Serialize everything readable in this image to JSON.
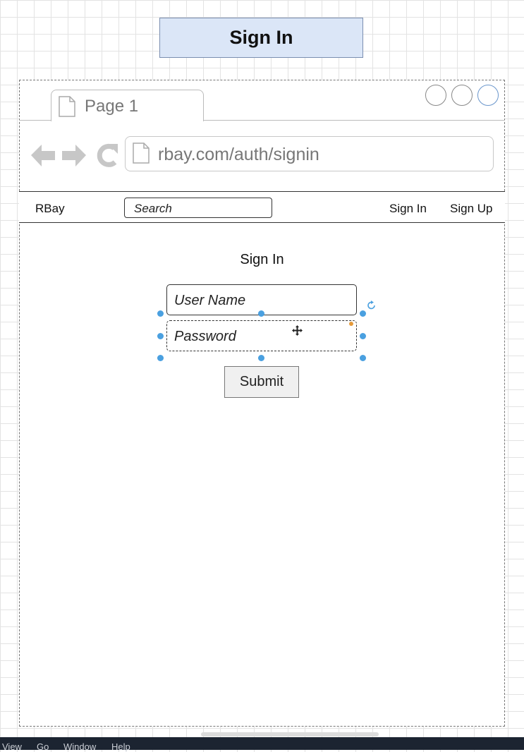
{
  "diagram": {
    "title": "Sign In"
  },
  "browser": {
    "tab_label": "Page 1",
    "url": "rbay.com/auth/signin"
  },
  "site_nav": {
    "brand": "RBay",
    "search_placeholder": "Search",
    "links": [
      "Sign In",
      "Sign Up"
    ]
  },
  "form": {
    "heading": "Sign In",
    "username_placeholder": "User Name",
    "password_placeholder": "Password",
    "submit_label": "Submit"
  },
  "app_menu": [
    "View",
    "Go",
    "Window",
    "Help"
  ],
  "colors": {
    "title_fill": "#dbe6f7",
    "selection_handle": "#4aa0e0",
    "window_button_active": "#6a96cc",
    "menubar": "#1c2431"
  },
  "icons": [
    "document-icon",
    "back-arrow-icon",
    "forward-arrow-icon",
    "reload-icon",
    "rotate-icon",
    "move-cursor-icon"
  ]
}
